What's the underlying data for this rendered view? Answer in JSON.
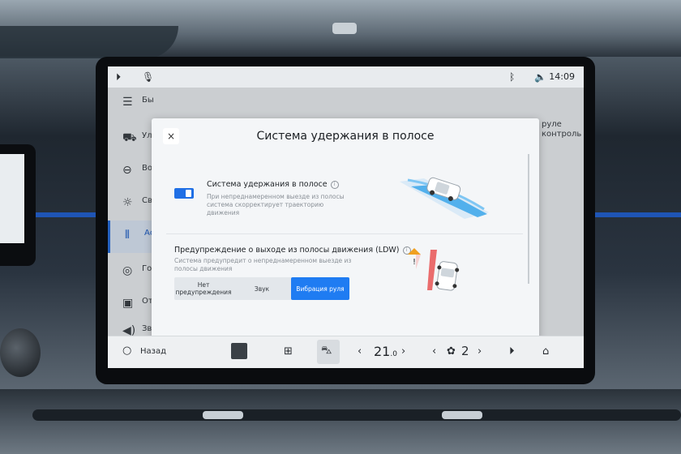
{
  "status_bar": {
    "time": "14:09",
    "icons": [
      "play-circle-icon",
      "microphone-icon",
      "bluetooth-icon",
      "volume-icon"
    ]
  },
  "sidebar": {
    "items": [
      {
        "icon": "sliders-icon",
        "label": "Бы"
      },
      {
        "icon": "car-icon",
        "label": "Ул"
      },
      {
        "icon": "steering-wheel-icon",
        "label": "Во"
      },
      {
        "icon": "light-bulb-icon",
        "label": "Св"
      },
      {
        "icon": "adas-icon",
        "label": "Ас во",
        "active": true
      },
      {
        "icon": "drive-mode-icon",
        "label": "Го по"
      },
      {
        "icon": "display-icon",
        "label": "От"
      },
      {
        "icon": "speaker-icon",
        "label": "Звук"
      }
    ]
  },
  "background_panel": {
    "text_line1": "руле",
    "text_line2": "контроль"
  },
  "modal": {
    "close_label": "×",
    "title": "Система удержания в полосе",
    "option1": {
      "title": "Система удержания в полосе",
      "description": "При непреднамеренном выезде из полосы система скорректирует траекторию движения",
      "enabled": true
    },
    "option2": {
      "title": "Предупреждение о выходе из полосы движения (LDW)",
      "description": "Система предупредит о непреднамеренном выезде из полосы движения",
      "segments": [
        "Нет предупреждения",
        "Звук",
        "Вибрация руля"
      ],
      "selected": "Вибрация руля"
    }
  },
  "bottom_bar": {
    "back_label": "Назад",
    "temperature": "21",
    "temperature_decimal": ".0",
    "fan_level": "2"
  },
  "colors": {
    "accent": "#1f7cf2",
    "toggle": "#1f6fe5",
    "warning": "#f0a020"
  }
}
